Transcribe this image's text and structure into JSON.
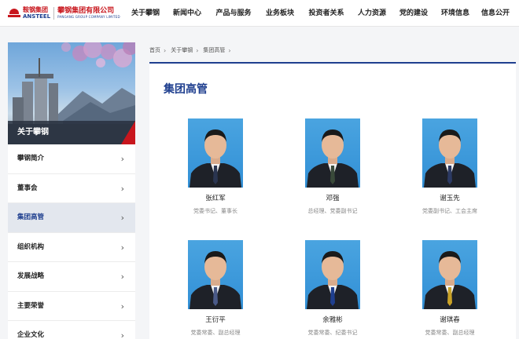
{
  "header": {
    "logo": {
      "cn_short": "鞍钢集团",
      "en_short": "ANSTEEL",
      "cn_full": "攀钢集团有限公司",
      "en_full": "PANGANG GROUP COMPANY LIMITED"
    },
    "nav": [
      "关于攀钢",
      "新闻中心",
      "产品与服务",
      "业务板块",
      "投资者关系",
      "人力资源",
      "党的建设",
      "环境信息",
      "信息公开"
    ]
  },
  "sidebar": {
    "title": "关于攀钢",
    "items": [
      {
        "label": "攀钢简介",
        "active": false
      },
      {
        "label": "董事会",
        "active": false
      },
      {
        "label": "集团高管",
        "active": true
      },
      {
        "label": "组织机构",
        "active": false
      },
      {
        "label": "发展战略",
        "active": false
      },
      {
        "label": "主要荣誉",
        "active": false
      },
      {
        "label": "企业文化",
        "active": false
      }
    ]
  },
  "breadcrumb": [
    "首页",
    "关于攀钢",
    "集团高管"
  ],
  "main": {
    "title": "集团高管",
    "executives": [
      {
        "name": "张红军",
        "role": "党委书记、董事长",
        "tie": "#2a3550"
      },
      {
        "name": "邓强",
        "role": "总经理、党委副书记",
        "tie": "#3a4a3a"
      },
      {
        "name": "谢玉先",
        "role": "党委副书记、工会主席",
        "tie": "#2c3a64"
      },
      {
        "name": "王衍平",
        "role": "党委常委、副总经理",
        "tie": "#4a5a88"
      },
      {
        "name": "余雅彬",
        "role": "党委常委、纪委书记",
        "tie": "#1f3f8f"
      },
      {
        "name": "谢琪春",
        "role": "党委常委、副总经理",
        "tie": "#c9a227"
      }
    ]
  },
  "colors": {
    "brand_blue": "#1f3f8f",
    "brand_red": "#c8161d",
    "photo_bg": "#3a96da"
  }
}
